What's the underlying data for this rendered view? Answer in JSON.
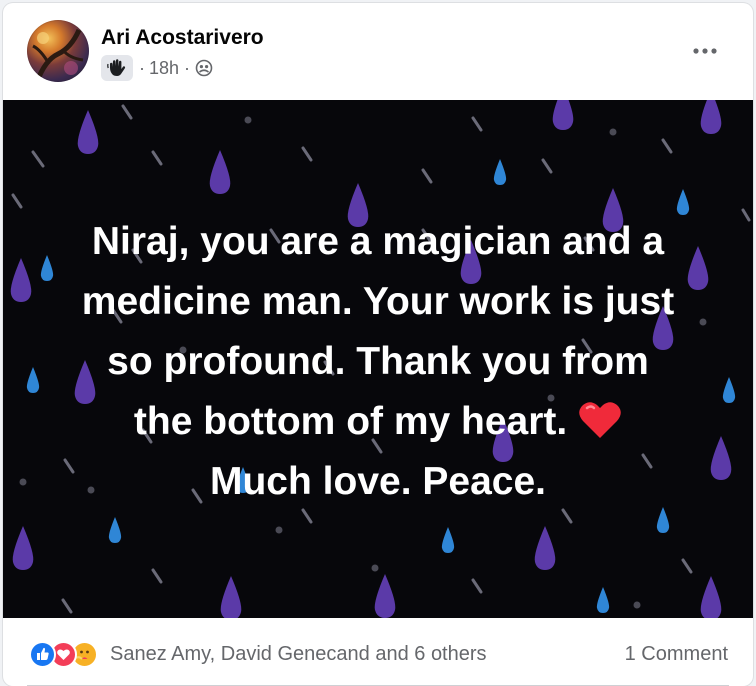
{
  "post": {
    "author": "Ari Acostarivero",
    "timestamp": "18h",
    "audience_icon": "group-icon",
    "badge_icon": "wave-hand-icon",
    "more_icon": "more-horizontal-icon",
    "text_lines": [
      "Niraj, you are a magician and a",
      "medicine man. Your work is just",
      "so profound. Thank you from",
      "the bottom of my heart.",
      "Much love. Peace."
    ],
    "heart_emoji": "❤️",
    "background": "dark rain drops",
    "colors": {
      "background": "#07070b",
      "drop_purple": "#5b3aa8",
      "drop_blue": "#2f86d6",
      "streak": "#6a6a78"
    }
  },
  "reactions": {
    "icons": [
      "like-icon",
      "love-icon",
      "care-icon"
    ],
    "names": "Sanez Amy, David Genecand and 6 others",
    "comments": "1 Comment"
  }
}
